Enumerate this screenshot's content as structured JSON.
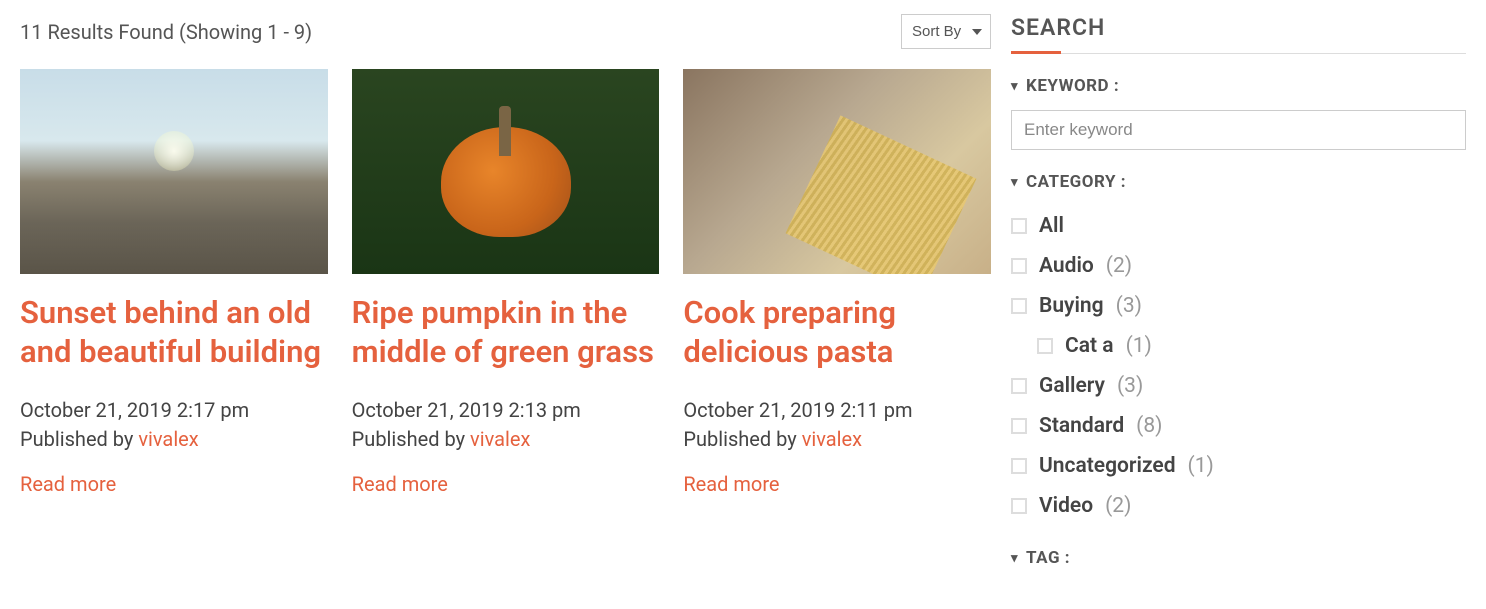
{
  "results": {
    "text": "11 Results Found (Showing 1 - 9)"
  },
  "sort": {
    "label": "Sort By"
  },
  "cards": [
    {
      "title": "Sunset behind an old and beautiful building",
      "meta": "October 21, 2019 2:17 pm Published by ",
      "author": "vivalex",
      "read_more": "Read more"
    },
    {
      "title": "Ripe pumpkin in the middle of green grass",
      "meta": "October 21, 2019 2:13 pm Published by ",
      "author": "vivalex",
      "read_more": "Read more"
    },
    {
      "title": "Cook preparing delicious pasta",
      "meta": "October 21, 2019 2:11 pm Published by ",
      "author": "vivalex",
      "read_more": "Read more"
    }
  ],
  "sidebar": {
    "title": "SEARCH",
    "keyword": {
      "label": "KEYWORD :",
      "placeholder": "Enter keyword"
    },
    "category": {
      "label": "CATEGORY :",
      "items": [
        {
          "name": "All",
          "count": "",
          "indent": false
        },
        {
          "name": "Audio",
          "count": "(2)",
          "indent": false
        },
        {
          "name": "Buying",
          "count": "(3)",
          "indent": false
        },
        {
          "name": "Cat a",
          "count": "(1)",
          "indent": true
        },
        {
          "name": "Gallery",
          "count": "(3)",
          "indent": false
        },
        {
          "name": "Standard",
          "count": "(8)",
          "indent": false
        },
        {
          "name": "Uncategorized",
          "count": "(1)",
          "indent": false
        },
        {
          "name": "Video",
          "count": "(2)",
          "indent": false
        }
      ]
    },
    "tag": {
      "label": "TAG :"
    }
  }
}
